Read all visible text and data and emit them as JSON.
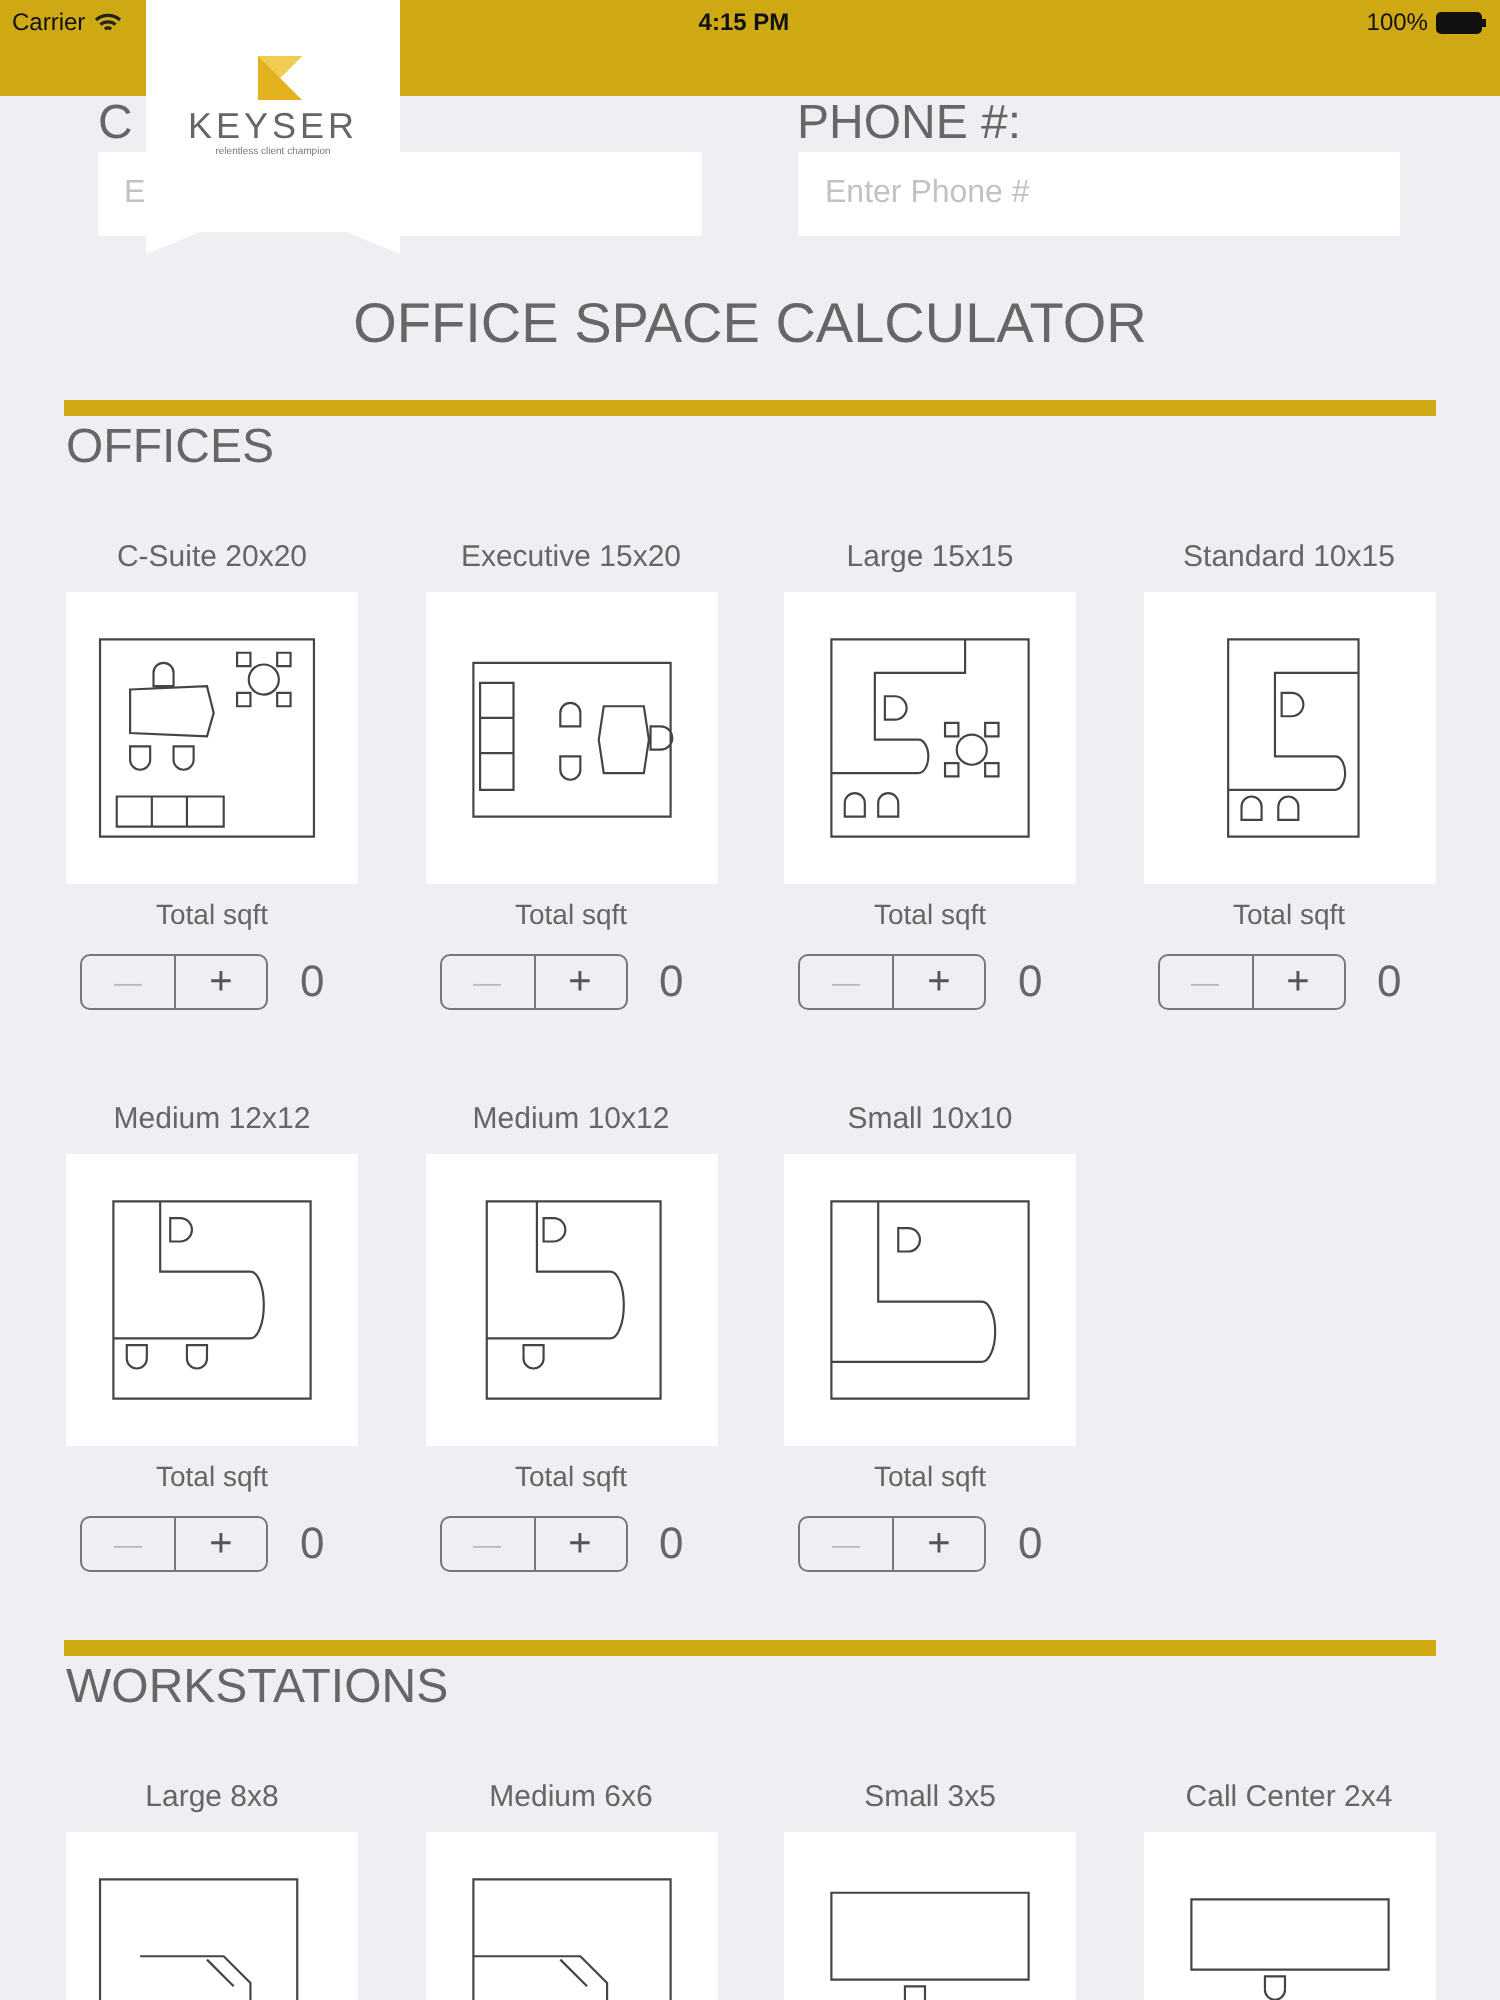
{
  "status_bar": {
    "carrier": "Carrier",
    "time": "4:15 PM",
    "battery": "100%"
  },
  "logo": {
    "name": "KEYSER",
    "tagline": "relentless client champion"
  },
  "form": [
    {
      "label": "C",
      "placeholder": "E"
    },
    {
      "label": "PHONE #:",
      "placeholder": "Enter Phone #"
    }
  ],
  "title": "OFFICE SPACE CALCULATOR",
  "sections": [
    {
      "heading": "OFFICES",
      "items": [
        {
          "name": "C-Suite 20x20",
          "kind": "csuite",
          "total_label": "Total sqft",
          "minus": "—",
          "plus": "+",
          "value": "0",
          "minus_disabled": true
        },
        {
          "name": "Executive 15x20",
          "kind": "executive",
          "total_label": "Total sqft",
          "minus": "—",
          "plus": "+",
          "value": "0",
          "minus_disabled": true
        },
        {
          "name": "Large 15x15",
          "kind": "large",
          "total_label": "Total sqft",
          "minus": "—",
          "plus": "+",
          "value": "0",
          "minus_disabled": true
        },
        {
          "name": "Standard 10x15",
          "kind": "standard",
          "total_label": "Total sqft",
          "minus": "—",
          "plus": "+",
          "value": "0",
          "minus_disabled": true
        },
        {
          "name": "Medium 12x12",
          "kind": "medium2",
          "total_label": "Total sqft",
          "minus": "—",
          "plus": "+",
          "value": "0",
          "minus_disabled": true
        },
        {
          "name": "Medium 10x12",
          "kind": "medium1",
          "total_label": "Total sqft",
          "minus": "—",
          "plus": "+",
          "value": "0",
          "minus_disabled": true
        },
        {
          "name": "Small 10x10",
          "kind": "small",
          "total_label": "Total sqft",
          "minus": "—",
          "plus": "+",
          "value": "0",
          "minus_disabled": true
        }
      ]
    },
    {
      "heading": "WORKSTATIONS",
      "items": [
        {
          "name": "Large 8x8",
          "kind": "ws_large"
        },
        {
          "name": "Medium 6x6",
          "kind": "ws_medium"
        },
        {
          "name": "Small 3x5",
          "kind": "ws_small"
        },
        {
          "name": "Call Center 2x4",
          "kind": "ws_call"
        }
      ]
    }
  ]
}
